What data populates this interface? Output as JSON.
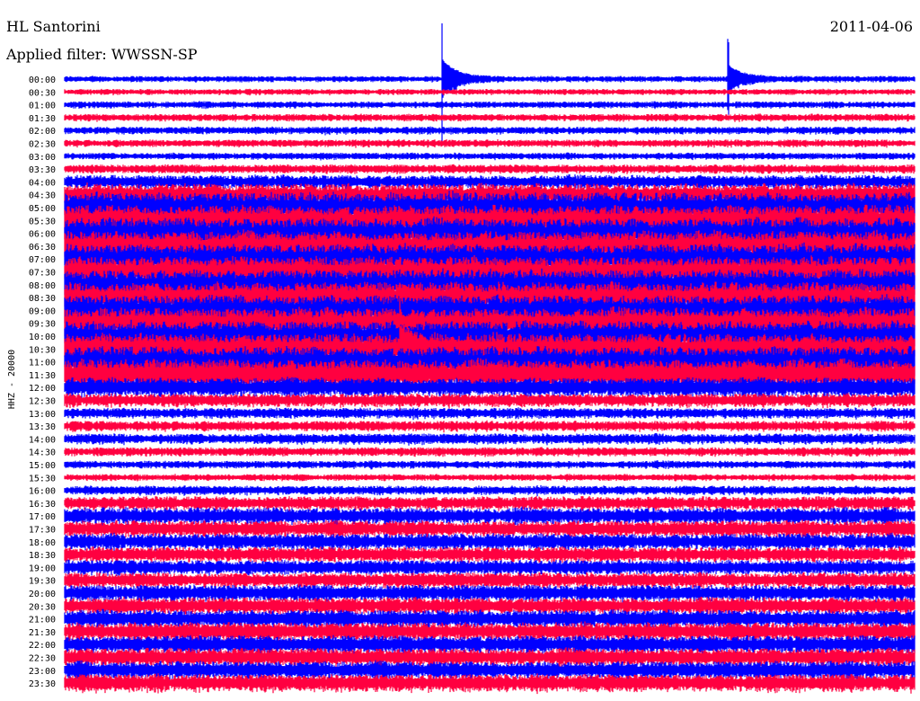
{
  "header": {
    "station": "HL Santorini",
    "date": "2011-04-06",
    "filter": "Applied filter: WWSSN-SP"
  },
  "chart_data": {
    "type": "line",
    "title": "HL Santorini",
    "subtitle": "Applied filter: WWSSN-SP",
    "ylabel": "HHZ - 20000",
    "xlabel": "",
    "x_range_minutes": [
      0,
      30
    ],
    "row_labels": [
      "00:00",
      "00:30",
      "01:00",
      "01:30",
      "02:00",
      "02:30",
      "03:00",
      "03:30",
      "04:00",
      "04:30",
      "05:00",
      "05:30",
      "06:00",
      "06:30",
      "07:00",
      "07:30",
      "08:00",
      "08:30",
      "09:00",
      "09:30",
      "10:00",
      "10:30",
      "11:00",
      "11:30",
      "12:00",
      "12:30",
      "13:00",
      "13:30",
      "14:00",
      "14:30",
      "15:00",
      "15:30",
      "16:00",
      "16:30",
      "17:00",
      "17:30",
      "18:00",
      "18:30",
      "19:00",
      "19:30",
      "20:00",
      "20:30",
      "21:00",
      "21:30",
      "22:00",
      "22:30",
      "23:00",
      "23:30"
    ],
    "relative_amplitude": [
      0.4,
      0.4,
      0.45,
      0.5,
      0.5,
      0.5,
      0.45,
      0.6,
      0.9,
      1.5,
      2.0,
      2.0,
      2.0,
      2.0,
      2.0,
      2.0,
      2.0,
      2.0,
      2.0,
      2.0,
      2.0,
      2.0,
      2.0,
      2.0,
      1.3,
      0.9,
      0.7,
      0.7,
      0.7,
      0.6,
      0.5,
      0.45,
      0.6,
      0.9,
      1.1,
      1.1,
      1.1,
      1.0,
      1.0,
      1.0,
      1.1,
      1.1,
      1.2,
      1.2,
      1.2,
      1.2,
      1.2,
      1.2
    ],
    "events": [
      {
        "row": "00:00",
        "minute": 13.3,
        "amplitude": 3.0
      },
      {
        "row": "00:00",
        "minute": 23.4,
        "amplitude": 2.0
      },
      {
        "row": "10:30",
        "minute": 11.8,
        "amplitude": 2.5
      }
    ],
    "series_colors": [
      "#0000ff",
      "#ff0040"
    ],
    "grid": false
  }
}
